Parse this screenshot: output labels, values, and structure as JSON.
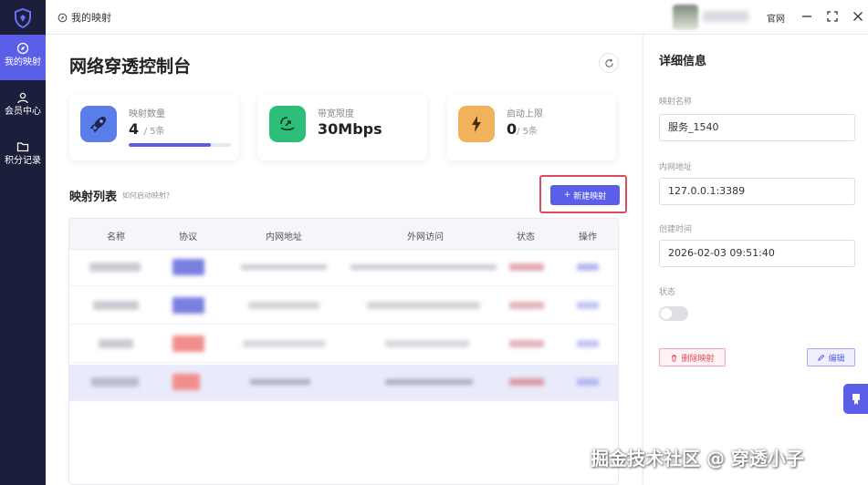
{
  "sidebar": {
    "items": [
      {
        "label": "我的映射",
        "icon": "compass-icon",
        "active": true
      },
      {
        "label": "会员中心",
        "icon": "user-icon",
        "active": false
      },
      {
        "label": "积分记录",
        "icon": "folder-icon",
        "active": false
      }
    ]
  },
  "topbar": {
    "title": "我的映射",
    "official_link": "官网"
  },
  "main": {
    "title": "网络穿透控制台",
    "stats": [
      {
        "label": "映射数量",
        "value": "4",
        "suffix": "/ 5条",
        "progress": 0.8
      },
      {
        "label": "带宽限度",
        "value": "30Mbps",
        "suffix": ""
      },
      {
        "label": "启动上限",
        "value": "0",
        "suffix": "/ 5条"
      }
    ],
    "list_title": "映射列表",
    "list_hint": "如何启动映射?",
    "new_button": "新建映射",
    "table_headers": [
      "名称",
      "协议",
      "内网地址",
      "外网访问",
      "状态",
      "操作"
    ]
  },
  "detail": {
    "title": "详细信息",
    "name_label": "映射名称",
    "name_value": "服务_1540",
    "addr_label": "内网地址",
    "addr_value": "127.0.0.1:3389",
    "created_label": "创建时间",
    "created_value": "2026-02-03 09:51:40",
    "status_label": "状态",
    "delete_button": "删除映射",
    "edit_button": "编辑"
  },
  "watermark": "掘金技术社区 @ 穿透小子",
  "colors": {
    "accent": "#5b5fe8",
    "sidebar": "#1c1f3b",
    "danger": "#e04a5f"
  }
}
